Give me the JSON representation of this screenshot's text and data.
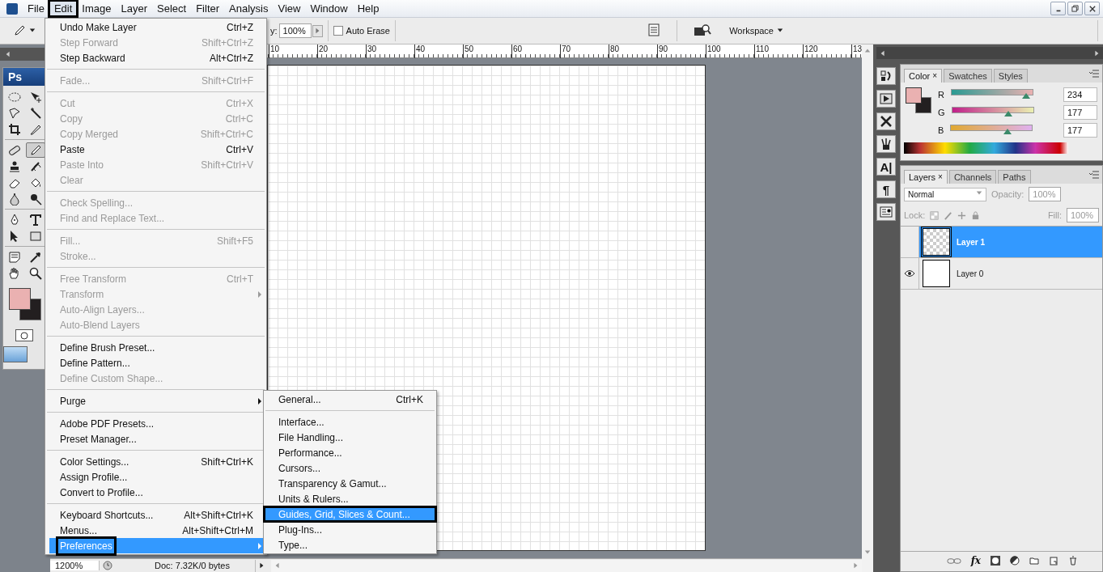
{
  "menubar": {
    "items": [
      {
        "label": "File",
        "selected": false
      },
      {
        "label": "Edit",
        "selected": true
      },
      {
        "label": "Image",
        "selected": false
      },
      {
        "label": "Layer",
        "selected": false
      },
      {
        "label": "Select",
        "selected": false
      },
      {
        "label": "Filter",
        "selected": false
      },
      {
        "label": "Analysis",
        "selected": false
      },
      {
        "label": "View",
        "selected": false
      },
      {
        "label": "Window",
        "selected": false
      },
      {
        "label": "Help",
        "selected": false
      }
    ]
  },
  "options_bar": {
    "opacity_label": "y:",
    "opacity": "100%",
    "auto_erase": {
      "label": "Auto Erase",
      "checked": false
    },
    "workspace": "Workspace"
  },
  "toolbox": {
    "logo": "Ps",
    "tools": [
      {
        "kind": "ellipse",
        "selected": false
      },
      {
        "kind": "move",
        "selected": false
      },
      {
        "kind": "lasso",
        "selected": false
      },
      {
        "kind": "wand",
        "selected": false
      },
      {
        "kind": "crop",
        "selected": false
      },
      {
        "kind": "slice",
        "selected": false
      },
      {
        "kind": "bandage",
        "selected": false
      },
      {
        "kind": "pencil",
        "selected": true
      },
      {
        "kind": "stamp",
        "selected": false
      },
      {
        "kind": "history",
        "selected": false
      },
      {
        "kind": "eraser",
        "selected": false
      },
      {
        "kind": "bucket",
        "selected": false
      },
      {
        "kind": "drop",
        "selected": false
      },
      {
        "kind": "burn",
        "selected": false
      },
      {
        "kind": "pen",
        "selected": false
      },
      {
        "kind": "type",
        "selected": false
      },
      {
        "kind": "arrow",
        "selected": false
      },
      {
        "kind": "rect",
        "selected": false
      },
      {
        "kind": "note",
        "selected": false
      },
      {
        "kind": "eyedropper",
        "selected": false
      },
      {
        "kind": "hand",
        "selected": false
      },
      {
        "kind": "zoom",
        "selected": false
      }
    ]
  },
  "document": {
    "ruler_labels": [
      "10",
      "20",
      "30",
      "40",
      "50",
      "60",
      "70",
      "80",
      "90",
      "100",
      "110",
      "120",
      "13"
    ],
    "zoom": "1200%",
    "doc_info": "Doc: 7.32K/0 bytes"
  },
  "edit_menu": {
    "items": [
      {
        "kind": "item",
        "label": "Undo Make Layer",
        "shortcut": "Ctrl+Z",
        "disabled": false
      },
      {
        "kind": "item",
        "label": "Step Forward",
        "shortcut": "Shift+Ctrl+Z",
        "disabled": true
      },
      {
        "kind": "item",
        "label": "Step Backward",
        "shortcut": "Alt+Ctrl+Z",
        "disabled": false
      },
      {
        "kind": "separator"
      },
      {
        "kind": "item",
        "label": "Fade...",
        "shortcut": "Shift+Ctrl+F",
        "disabled": true
      },
      {
        "kind": "separator"
      },
      {
        "kind": "item",
        "label": "Cut",
        "shortcut": "Ctrl+X",
        "disabled": true
      },
      {
        "kind": "item",
        "label": "Copy",
        "shortcut": "Ctrl+C",
        "disabled": true
      },
      {
        "kind": "item",
        "label": "Copy Merged",
        "shortcut": "Shift+Ctrl+C",
        "disabled": true
      },
      {
        "kind": "item",
        "label": "Paste",
        "shortcut": "Ctrl+V",
        "disabled": false
      },
      {
        "kind": "item",
        "label": "Paste Into",
        "shortcut": "Shift+Ctrl+V",
        "disabled": true
      },
      {
        "kind": "item",
        "label": "Clear",
        "disabled": true
      },
      {
        "kind": "separator"
      },
      {
        "kind": "item",
        "label": "Check Spelling...",
        "disabled": true
      },
      {
        "kind": "item",
        "label": "Find and Replace Text...",
        "disabled": true
      },
      {
        "kind": "separator"
      },
      {
        "kind": "item",
        "label": "Fill...",
        "shortcut": "Shift+F5",
        "disabled": true
      },
      {
        "kind": "item",
        "label": "Stroke...",
        "disabled": true
      },
      {
        "kind": "separator"
      },
      {
        "kind": "item",
        "label": "Free Transform",
        "shortcut": "Ctrl+T",
        "disabled": true
      },
      {
        "kind": "submenu",
        "label": "Transform",
        "disabled": true
      },
      {
        "kind": "item",
        "label": "Auto-Align Layers...",
        "disabled": true
      },
      {
        "kind": "item",
        "label": "Auto-Blend Layers",
        "disabled": true
      },
      {
        "kind": "separator"
      },
      {
        "kind": "item",
        "label": "Define Brush Preset...",
        "disabled": false
      },
      {
        "kind": "item",
        "label": "Define Pattern...",
        "disabled": false
      },
      {
        "kind": "item",
        "label": "Define Custom Shape...",
        "disabled": true
      },
      {
        "kind": "separator"
      },
      {
        "kind": "submenu",
        "label": "Purge",
        "disabled": false
      },
      {
        "kind": "separator"
      },
      {
        "kind": "item",
        "label": "Adobe PDF Presets...",
        "disabled": false
      },
      {
        "kind": "item",
        "label": "Preset Manager...",
        "disabled": false
      },
      {
        "kind": "separator"
      },
      {
        "kind": "item",
        "label": "Color Settings...",
        "shortcut": "Shift+Ctrl+K",
        "disabled": false
      },
      {
        "kind": "item",
        "label": "Assign Profile...",
        "disabled": false
      },
      {
        "kind": "item",
        "label": "Convert to Profile...",
        "disabled": false
      },
      {
        "kind": "separator"
      },
      {
        "kind": "item",
        "label": "Keyboard Shortcuts...",
        "shortcut": "Alt+Shift+Ctrl+K",
        "disabled": false
      },
      {
        "kind": "item",
        "label": "Menus...",
        "shortcut": "Alt+Shift+Ctrl+M",
        "disabled": false
      },
      {
        "kind": "submenu",
        "label": "Preferences",
        "disabled": false,
        "selected": true
      }
    ]
  },
  "preferences_menu": {
    "items": [
      {
        "kind": "item",
        "label": "General...",
        "shortcut": "Ctrl+K",
        "selected": false
      },
      {
        "kind": "separator"
      },
      {
        "kind": "item",
        "label": "Interface...",
        "selected": false
      },
      {
        "kind": "item",
        "label": "File Handling...",
        "selected": false
      },
      {
        "kind": "item",
        "label": "Performance...",
        "selected": false
      },
      {
        "kind": "item",
        "label": "Cursors...",
        "selected": false
      },
      {
        "kind": "item",
        "label": "Transparency & Gamut...",
        "selected": false
      },
      {
        "kind": "item",
        "label": "Units & Rulers...",
        "selected": false
      },
      {
        "kind": "item",
        "label": "Guides, Grid, Slices & Count...",
        "selected": true
      },
      {
        "kind": "item",
        "label": "Plug-Ins...",
        "selected": false
      },
      {
        "kind": "item",
        "label": "Type...",
        "selected": false
      }
    ]
  },
  "dock_icons": [
    {
      "kind": "history"
    },
    {
      "kind": "play"
    },
    {
      "kind": "tools"
    },
    {
      "kind": "brushes"
    },
    {
      "kind": "glyph",
      "glyph": "A|"
    },
    {
      "kind": "glyph",
      "glyph": "¶"
    },
    {
      "kind": "comps"
    }
  ],
  "color_panel": {
    "tabs": [
      {
        "label": "Color",
        "selected": true,
        "close": "×"
      },
      {
        "label": "Swatches",
        "selected": false
      },
      {
        "label": "Styles",
        "selected": false
      }
    ],
    "channels": [
      {
        "name": "R",
        "value": "234",
        "level": 0.918
      },
      {
        "name": "G",
        "value": "177",
        "level": 0.694
      },
      {
        "name": "B",
        "value": "177",
        "level": 0.694
      }
    ]
  },
  "layers_panel": {
    "tabs": [
      {
        "label": "Layers",
        "selected": true,
        "close": "×"
      },
      {
        "label": "Channels",
        "selected": false
      },
      {
        "label": "Paths",
        "selected": false
      }
    ],
    "blend_mode": "Normal",
    "opacity_label": "Opacity:",
    "opacity": "100%",
    "lock_label": "Lock:",
    "fill_label": "Fill:",
    "fill": "100%",
    "layers": [
      {
        "name": "Layer 1",
        "selected": true,
        "visible": false,
        "transparent": true
      },
      {
        "name": "Layer 0",
        "selected": false,
        "visible": true,
        "transparent": false
      }
    ],
    "fx_label": "fx"
  }
}
